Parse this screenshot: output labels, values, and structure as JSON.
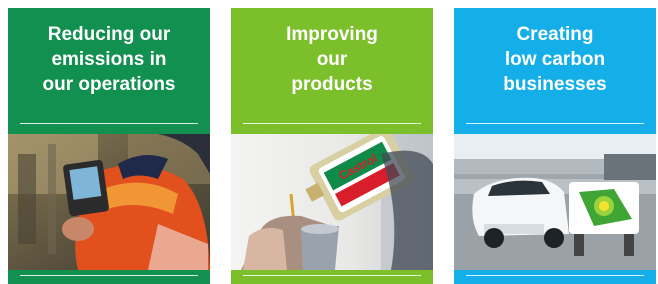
{
  "theme": {
    "green": "#119050",
    "lime": "#7bbf2b",
    "blue": "#14aee8"
  },
  "panels": [
    {
      "id": "operations",
      "lines": [
        "Reducing our",
        "emissions in",
        "our operations"
      ],
      "image": "worker-with-handheld-device-photo"
    },
    {
      "id": "products",
      "lines": [
        "Improving",
        "our",
        "products"
      ],
      "image": "pouring-castrol-oil-photo"
    },
    {
      "id": "businesses",
      "lines": [
        "Creating",
        "low carbon",
        "businesses"
      ],
      "image": "electric-car-charging-photo"
    }
  ]
}
